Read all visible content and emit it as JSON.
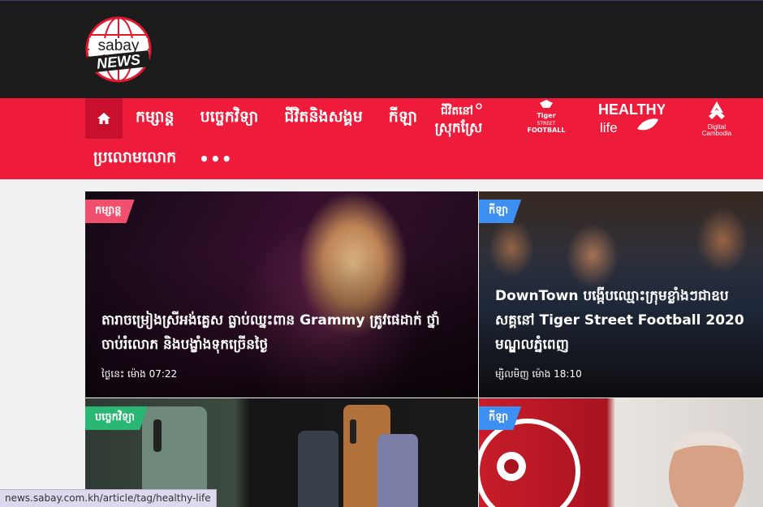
{
  "logo": {
    "top_word": "sabay",
    "bottom_word": "NEWS"
  },
  "nav": {
    "items_row1": [
      "កម្សាន្ត",
      "បច្ចេកវិទ្យា",
      "ជីវិតនិងសង្គម",
      "កីឡា"
    ],
    "items_row2": [
      "ប្រលោមលោក"
    ],
    "more": "•••",
    "partner_logos": [
      {
        "name": "rice-festival-logo",
        "text_top": "ជីវិតនៅ",
        "text_bottom": "ស្រុកស្រែ"
      },
      {
        "name": "tiger-street-football-logo",
        "line1": "Tiger",
        "line2": "STREET",
        "line3": "FOOTBALL"
      },
      {
        "name": "healthy-life-logo",
        "line1": "HEALTHY",
        "line2": "life"
      },
      {
        "name": "digital-cambodia-logo",
        "line1": "Digital",
        "line2": "Cambodia"
      }
    ]
  },
  "cards": [
    {
      "tag": "កម្សាន្ត",
      "tag_color": "#f0506e",
      "title": "តារាចម្រៀងស្រីអង់គ្លេស ធ្លាប់ឈ្នះពាន Grammy ត្រូវផេដាក់ ថ្នាំ ចាប់រំលោភ និងបង្ខាំងទុកច្រើនថ្ងៃ",
      "meta": "ថ្ងៃនេះ ម៉ោង 07:22"
    },
    {
      "tag": "កីឡា",
      "tag_color": "#3d8ff2",
      "title": "DownTown បង្កើបឈ្មោះក្រុមខ្លាំងៗជាឧប សគ្គនៅ Tiger Street Football 2020 មណ្ឌលភ្នំពេញ",
      "meta": "ម្សិលមិញ ម៉ោង 18:10"
    },
    {
      "tag": "បច្ចេកវិទ្យា",
      "tag_color": "#2ab673"
    },
    {
      "tag": "កីឡា",
      "tag_color": "#3d8ff2"
    }
  ],
  "status_bar": {
    "url": "news.sabay.com.kh/article/tag/healthy-life"
  },
  "colors": {
    "header_bg": "#1c1c1c",
    "nav_bg": "#ee1c3a",
    "home_bg": "#c8102e"
  }
}
